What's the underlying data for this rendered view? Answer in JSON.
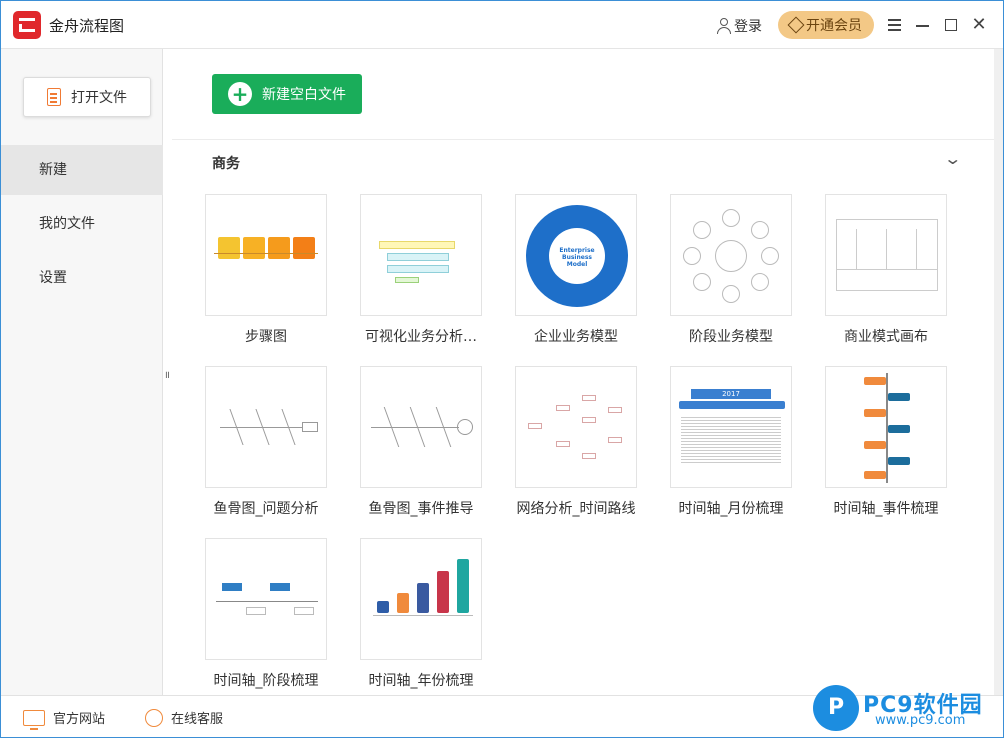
{
  "app": {
    "title": "金舟流程图"
  },
  "header": {
    "login_label": "登录",
    "vip_label": "开通会员"
  },
  "sidebar": {
    "open_file_label": "打开文件",
    "items": [
      {
        "label": "新建",
        "active": true
      },
      {
        "label": "我的文件",
        "active": false
      },
      {
        "label": "设置",
        "active": false
      }
    ]
  },
  "main": {
    "new_blank_label": "新建空白文件",
    "section_title": "商务",
    "templates": [
      {
        "label": "步骤图"
      },
      {
        "label": "可视化业务分析…"
      },
      {
        "label": "企业业务模型"
      },
      {
        "label": "阶段业务模型"
      },
      {
        "label": "商业模式画布"
      },
      {
        "label": "鱼骨图_问题分析"
      },
      {
        "label": "鱼骨图_事件推导"
      },
      {
        "label": "网络分析_时间路线"
      },
      {
        "label": "时间轴_月份梳理"
      },
      {
        "label": "时间轴_事件梳理"
      },
      {
        "label": "时间轴_阶段梳理"
      },
      {
        "label": "时间轴_年份梳理"
      }
    ]
  },
  "thumbnails": {
    "enterprise_title": "Enterprise Business Model",
    "timeline_year": "2017"
  },
  "footer": {
    "website_label": "官方网站",
    "service_label": "在线客服"
  },
  "watermark": {
    "brand": "PC9软件园",
    "url": "www.pc9.com"
  },
  "colors": {
    "accent_green": "#1aad5a",
    "vip_gold": "#f3c886",
    "brand_red": "#e0282c",
    "watermark_blue": "#1c8de0"
  }
}
